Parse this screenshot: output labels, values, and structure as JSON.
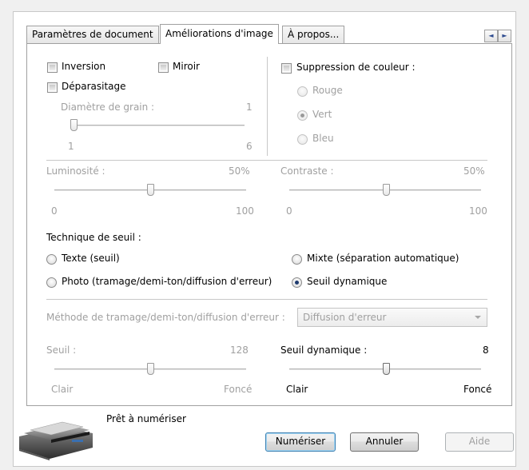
{
  "tabs": [
    {
      "label": "Paramètres de document",
      "active": false
    },
    {
      "label": "Améliorations d'image",
      "active": true
    },
    {
      "label": "À propos...",
      "active": false
    }
  ],
  "tab_nav": {
    "left_icon": "arrow-left-icon",
    "right_icon": "arrow-right-icon",
    "left_glyph": "◄",
    "right_glyph": "►"
  },
  "options": {
    "inversion": {
      "label": "Inversion",
      "checked": false
    },
    "miroir": {
      "label": "Miroir",
      "checked": false
    },
    "deparasitage": {
      "label": "Déparasitage",
      "checked": false
    },
    "grain": {
      "label": "Diamètre de grain :",
      "value": "1",
      "min": "1",
      "max": "6"
    }
  },
  "color_suppression": {
    "label": "Suppression de couleur :",
    "checked": false,
    "options": [
      {
        "label": "Rouge",
        "selected": false
      },
      {
        "label": "Vert",
        "selected": true
      },
      {
        "label": "Bleu",
        "selected": false
      }
    ]
  },
  "luminosity": {
    "label": "Luminosité :",
    "value": "50%",
    "min": "0",
    "max": "100",
    "level": 50
  },
  "contrast": {
    "label": "Contraste :",
    "value": "50%",
    "min": "0",
    "max": "100",
    "level": 50
  },
  "threshold_technique": {
    "label": "Technique de seuil :",
    "options": [
      {
        "label": "Texte (seuil)",
        "selected": false
      },
      {
        "label": "Mixte (séparation automatique)",
        "selected": false
      },
      {
        "label": "Photo (tramage/demi-ton/diffusion d'erreur)",
        "selected": false
      },
      {
        "label": "Seuil dynamique",
        "selected": true
      }
    ]
  },
  "dither_method": {
    "label": "Méthode de tramage/demi-ton/diffusion d'erreur :",
    "value": "Diffusion d'erreur"
  },
  "threshold": {
    "label": "Seuil :",
    "value": "128",
    "min_label": "Clair",
    "max_label": "Foncé",
    "level": 50
  },
  "dynamic_threshold": {
    "label": "Seuil dynamique :",
    "value": "8",
    "min_label": "Clair",
    "max_label": "Foncé",
    "level": 50
  },
  "status": {
    "text": "Prêt à numériser"
  },
  "buttons": {
    "scan": "Numériser",
    "cancel": "Annuler",
    "help": "Aide"
  },
  "colors": {
    "radio_dot": "#1e3b6e",
    "default_button_border": "#3c7fb1",
    "disabled_text": "#a0a0a0"
  }
}
